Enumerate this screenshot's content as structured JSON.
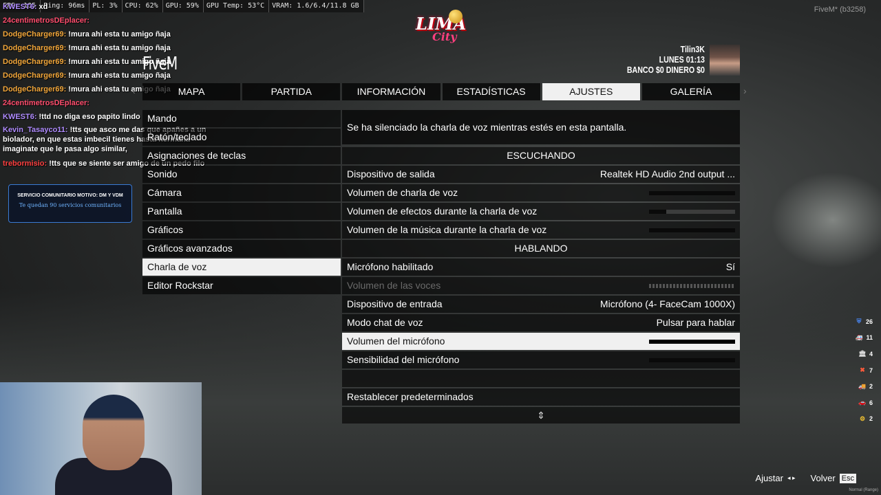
{
  "perf": [
    "FPS: 105",
    "Ping: 96ms",
    "PL: 3%",
    "CPU: 62%",
    "GPU: 59%",
    "GPU Temp: 53°C",
    "VRAM: 1.6/6.4/11.8 GB"
  ],
  "build": "FiveM* (b3258)",
  "chat": [
    {
      "user": "KWEST6:",
      "msg": "xd",
      "color": "#b08cff"
    },
    {
      "user": "24centimetrosDEplacer:",
      "msg": "",
      "color": "#ff4d6d"
    },
    {
      "user": "DodgeCharger69:",
      "msg": "!mura ahi esta tu amigo ñaja",
      "color": "#f2a73b"
    },
    {
      "user": "DodgeCharger69:",
      "msg": "!mura ahi esta tu amigo ñaja",
      "color": "#f2a73b"
    },
    {
      "user": "DodgeCharger69:",
      "msg": "!mura ahi esta tu amigo ñaja",
      "color": "#f2a73b"
    },
    {
      "user": "DodgeCharger69:",
      "msg": "!mura ahi esta tu amigo ñaja",
      "color": "#f2a73b"
    },
    {
      "user": "DodgeCharger69:",
      "msg": "!mura ahi esta tu amigo ñaja",
      "color": "#f2a73b"
    },
    {
      "user": "24centimetrosDEplacer:",
      "msg": "",
      "color": "#ff4d6d"
    },
    {
      "user": "KWEST6:",
      "msg": "!ttd no diga eso papito lindo",
      "color": "#b08cff"
    },
    {
      "user": "Kevin_Tasayco11:",
      "msg": "!tts que asco me das que apañes a un biolador, en que estas imbecil tienes hasta hermana imaginate que le pasa algo similar,",
      "color": "#b08cff"
    },
    {
      "user": "trebormisio:",
      "msg": "!tts que se siente ser amigo de un pedo filo",
      "color": "#ff4040"
    }
  ],
  "logo": {
    "line1": "LIMA",
    "line2": "City"
  },
  "brand": "FiveM",
  "player": {
    "name": "Tilin3K",
    "time": "LUNES 01:13",
    "money": "BANCO $0  DINERO $0"
  },
  "tabs": [
    {
      "label": "MAPA",
      "active": false
    },
    {
      "label": "PARTIDA",
      "active": false
    },
    {
      "label": "INFORMACIÓN",
      "active": false
    },
    {
      "label": "ESTADÍSTICAS",
      "active": false
    },
    {
      "label": "AJUSTES",
      "active": true
    },
    {
      "label": "GALERÍA",
      "active": false
    }
  ],
  "menu": [
    {
      "label": "Mando",
      "active": false
    },
    {
      "label": "Ratón/teclado",
      "active": false
    },
    {
      "label": "Asignaciones de teclas",
      "active": false
    },
    {
      "label": "Sonido",
      "active": false
    },
    {
      "label": "Cámara",
      "active": false
    },
    {
      "label": "Pantalla",
      "active": false
    },
    {
      "label": "Gráficos",
      "active": false
    },
    {
      "label": "Gráficos avanzados",
      "active": false
    },
    {
      "label": "Charla de voz",
      "active": true
    },
    {
      "label": "Editor Rockstar",
      "active": false
    }
  ],
  "notice": "Se ha silenciado la charla de voz mientras estés en esta pantalla.",
  "settings": [
    {
      "type": "section",
      "label": "ESCUCHANDO"
    },
    {
      "type": "value",
      "label": "Dispositivo de salida",
      "value": "Realtek HD Audio 2nd output ..."
    },
    {
      "type": "bar",
      "label": "Volumen de charla de voz",
      "level": 1.0
    },
    {
      "type": "bar",
      "label": "Volumen de efectos durante la charla de voz",
      "level": 0.2
    },
    {
      "type": "bar",
      "label": "Volumen de la música durante la charla de voz",
      "level": 1.0
    },
    {
      "type": "section",
      "label": "HABLANDO"
    },
    {
      "type": "value",
      "label": "Micrófono habilitado",
      "value": "Sí"
    },
    {
      "type": "bar",
      "label": "Volumen de las voces",
      "level": 0.0,
      "disabled": true
    },
    {
      "type": "value",
      "label": "Dispositivo de entrada",
      "value": "Micrófono (4- FaceCam 1000X)"
    },
    {
      "type": "value",
      "label": "Modo chat de voz",
      "value": "Pulsar para hablar"
    },
    {
      "type": "bar",
      "label": "Volumen del micrófono",
      "level": 1.0,
      "selected": true
    },
    {
      "type": "bar",
      "label": "Sensibilidad del micrófono",
      "level": 1.0
    },
    {
      "type": "blank",
      "label": ""
    },
    {
      "type": "value",
      "label": "Restablecer predeterminados",
      "value": ""
    }
  ],
  "scroll_icon": "⇕",
  "service": {
    "title": "SERVICIO COMUNITARIO MOTIVO: DM Y VDM",
    "subtitle": "Te quedan 90 servicios comunitarios"
  },
  "hud": [
    {
      "icon": "shield-icon",
      "glyph": "⛨",
      "count": "26",
      "color": "#4a8cff"
    },
    {
      "icon": "ambulance-icon",
      "glyph": "🚑",
      "count": "11",
      "color": "#ff3b3b"
    },
    {
      "icon": "bank-icon",
      "glyph": "🏛",
      "count": "4",
      "color": "#dddddd"
    },
    {
      "icon": "tools-icon",
      "glyph": "✖",
      "count": "7",
      "color": "#ff5a3b"
    },
    {
      "icon": "truck-icon",
      "glyph": "🚚",
      "count": "2",
      "color": "#dddddd"
    },
    {
      "icon": "car-icon",
      "glyph": "🚗",
      "count": "6",
      "color": "#ff3b3b"
    },
    {
      "icon": "gears-icon",
      "glyph": "⚙",
      "count": "2",
      "color": "#f2c230"
    }
  ],
  "footer": {
    "adjust": "Ajustar",
    "back": "Volver",
    "key": "Esc"
  },
  "normal": "Normal (Range)"
}
